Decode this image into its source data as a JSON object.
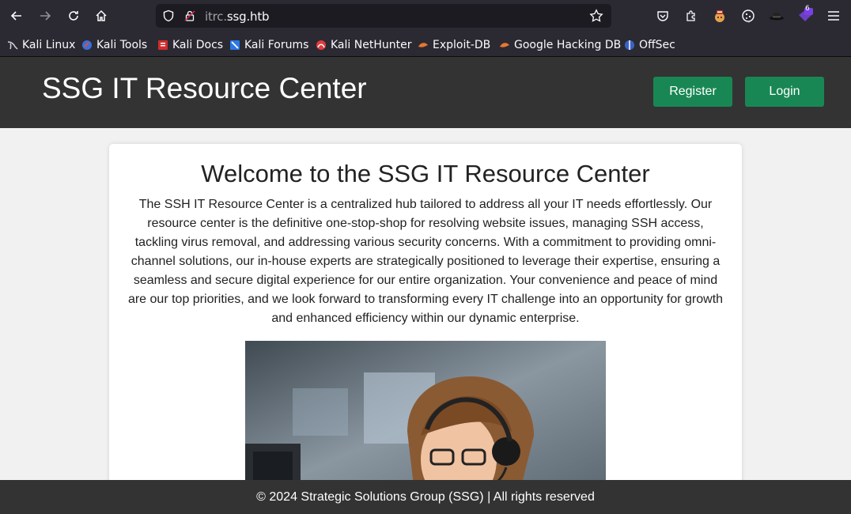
{
  "browser": {
    "url_prefix": "itrc.",
    "url_domain": "ssg.htb",
    "extension_badge": "6",
    "bookmarks": [
      {
        "label": "Kali Linux",
        "icon": "kali-dragon-icon"
      },
      {
        "label": "Kali Tools",
        "icon": "kali-tools-icon"
      },
      {
        "label": "Kali Docs",
        "icon": "kali-docs-icon"
      },
      {
        "label": "Kali Forums",
        "icon": "kali-forums-icon"
      },
      {
        "label": "Kali NetHunter",
        "icon": "nethunter-icon"
      },
      {
        "label": "Exploit-DB",
        "icon": "exploit-db-icon"
      },
      {
        "label": "Google Hacking DB",
        "icon": "ghdb-icon"
      },
      {
        "label": "OffSec",
        "icon": "offsec-icon"
      }
    ]
  },
  "site": {
    "title": "SSG IT Resource Center",
    "register_label": "Register",
    "login_label": "Login",
    "accent": "#198754"
  },
  "main": {
    "heading": "Welcome to the SSG IT Resource Center",
    "intro": "The SSH IT Resource Center is a centralized hub tailored to address all your IT needs effortlessly. Our resource center is the definitive one-stop-shop for resolving website issues, managing SSH access, tackling virus removal, and addressing various security concerns. With a commitment to providing omni-channel solutions, our in-house experts are strategically positioned to leverage their expertise, ensuring a seamless and secure digital experience for our entire organization. Your convenience and peace of mind are our top priorities, and we look forward to transforming every IT challenge into an opportunity for growth and enhanced efficiency within our dynamic enterprise."
  },
  "footer": {
    "text": "© 2024 Strategic Solutions Group (SSG) | All rights reserved"
  }
}
